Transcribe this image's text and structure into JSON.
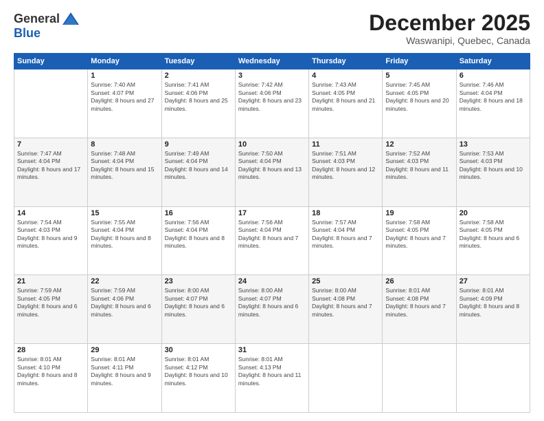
{
  "header": {
    "logo_general": "General",
    "logo_blue": "Blue",
    "month_title": "December 2025",
    "location": "Waswanipi, Quebec, Canada"
  },
  "weekdays": [
    "Sunday",
    "Monday",
    "Tuesday",
    "Wednesday",
    "Thursday",
    "Friday",
    "Saturday"
  ],
  "weeks": [
    [
      {
        "day": "",
        "sunrise": "",
        "sunset": "",
        "daylight": ""
      },
      {
        "day": "1",
        "sunrise": "7:40 AM",
        "sunset": "4:07 PM",
        "daylight": "8 hours and 27 minutes."
      },
      {
        "day": "2",
        "sunrise": "7:41 AM",
        "sunset": "4:06 PM",
        "daylight": "8 hours and 25 minutes."
      },
      {
        "day": "3",
        "sunrise": "7:42 AM",
        "sunset": "4:06 PM",
        "daylight": "8 hours and 23 minutes."
      },
      {
        "day": "4",
        "sunrise": "7:43 AM",
        "sunset": "4:05 PM",
        "daylight": "8 hours and 21 minutes."
      },
      {
        "day": "5",
        "sunrise": "7:45 AM",
        "sunset": "4:05 PM",
        "daylight": "8 hours and 20 minutes."
      },
      {
        "day": "6",
        "sunrise": "7:46 AM",
        "sunset": "4:04 PM",
        "daylight": "8 hours and 18 minutes."
      }
    ],
    [
      {
        "day": "7",
        "sunrise": "7:47 AM",
        "sunset": "4:04 PM",
        "daylight": "8 hours and 17 minutes."
      },
      {
        "day": "8",
        "sunrise": "7:48 AM",
        "sunset": "4:04 PM",
        "daylight": "8 hours and 15 minutes."
      },
      {
        "day": "9",
        "sunrise": "7:49 AM",
        "sunset": "4:04 PM",
        "daylight": "8 hours and 14 minutes."
      },
      {
        "day": "10",
        "sunrise": "7:50 AM",
        "sunset": "4:04 PM",
        "daylight": "8 hours and 13 minutes."
      },
      {
        "day": "11",
        "sunrise": "7:51 AM",
        "sunset": "4:03 PM",
        "daylight": "8 hours and 12 minutes."
      },
      {
        "day": "12",
        "sunrise": "7:52 AM",
        "sunset": "4:03 PM",
        "daylight": "8 hours and 11 minutes."
      },
      {
        "day": "13",
        "sunrise": "7:53 AM",
        "sunset": "4:03 PM",
        "daylight": "8 hours and 10 minutes."
      }
    ],
    [
      {
        "day": "14",
        "sunrise": "7:54 AM",
        "sunset": "4:03 PM",
        "daylight": "8 hours and 9 minutes."
      },
      {
        "day": "15",
        "sunrise": "7:55 AM",
        "sunset": "4:04 PM",
        "daylight": "8 hours and 8 minutes."
      },
      {
        "day": "16",
        "sunrise": "7:56 AM",
        "sunset": "4:04 PM",
        "daylight": "8 hours and 8 minutes."
      },
      {
        "day": "17",
        "sunrise": "7:56 AM",
        "sunset": "4:04 PM",
        "daylight": "8 hours and 7 minutes."
      },
      {
        "day": "18",
        "sunrise": "7:57 AM",
        "sunset": "4:04 PM",
        "daylight": "8 hours and 7 minutes."
      },
      {
        "day": "19",
        "sunrise": "7:58 AM",
        "sunset": "4:05 PM",
        "daylight": "8 hours and 7 minutes."
      },
      {
        "day": "20",
        "sunrise": "7:58 AM",
        "sunset": "4:05 PM",
        "daylight": "8 hours and 6 minutes."
      }
    ],
    [
      {
        "day": "21",
        "sunrise": "7:59 AM",
        "sunset": "4:05 PM",
        "daylight": "8 hours and 6 minutes."
      },
      {
        "day": "22",
        "sunrise": "7:59 AM",
        "sunset": "4:06 PM",
        "daylight": "8 hours and 6 minutes."
      },
      {
        "day": "23",
        "sunrise": "8:00 AM",
        "sunset": "4:07 PM",
        "daylight": "8 hours and 6 minutes."
      },
      {
        "day": "24",
        "sunrise": "8:00 AM",
        "sunset": "4:07 PM",
        "daylight": "8 hours and 6 minutes."
      },
      {
        "day": "25",
        "sunrise": "8:00 AM",
        "sunset": "4:08 PM",
        "daylight": "8 hours and 7 minutes."
      },
      {
        "day": "26",
        "sunrise": "8:01 AM",
        "sunset": "4:08 PM",
        "daylight": "8 hours and 7 minutes."
      },
      {
        "day": "27",
        "sunrise": "8:01 AM",
        "sunset": "4:09 PM",
        "daylight": "8 hours and 8 minutes."
      }
    ],
    [
      {
        "day": "28",
        "sunrise": "8:01 AM",
        "sunset": "4:10 PM",
        "daylight": "8 hours and 8 minutes."
      },
      {
        "day": "29",
        "sunrise": "8:01 AM",
        "sunset": "4:11 PM",
        "daylight": "8 hours and 9 minutes."
      },
      {
        "day": "30",
        "sunrise": "8:01 AM",
        "sunset": "4:12 PM",
        "daylight": "8 hours and 10 minutes."
      },
      {
        "day": "31",
        "sunrise": "8:01 AM",
        "sunset": "4:13 PM",
        "daylight": "8 hours and 11 minutes."
      },
      {
        "day": "",
        "sunrise": "",
        "sunset": "",
        "daylight": ""
      },
      {
        "day": "",
        "sunrise": "",
        "sunset": "",
        "daylight": ""
      },
      {
        "day": "",
        "sunrise": "",
        "sunset": "",
        "daylight": ""
      }
    ]
  ]
}
